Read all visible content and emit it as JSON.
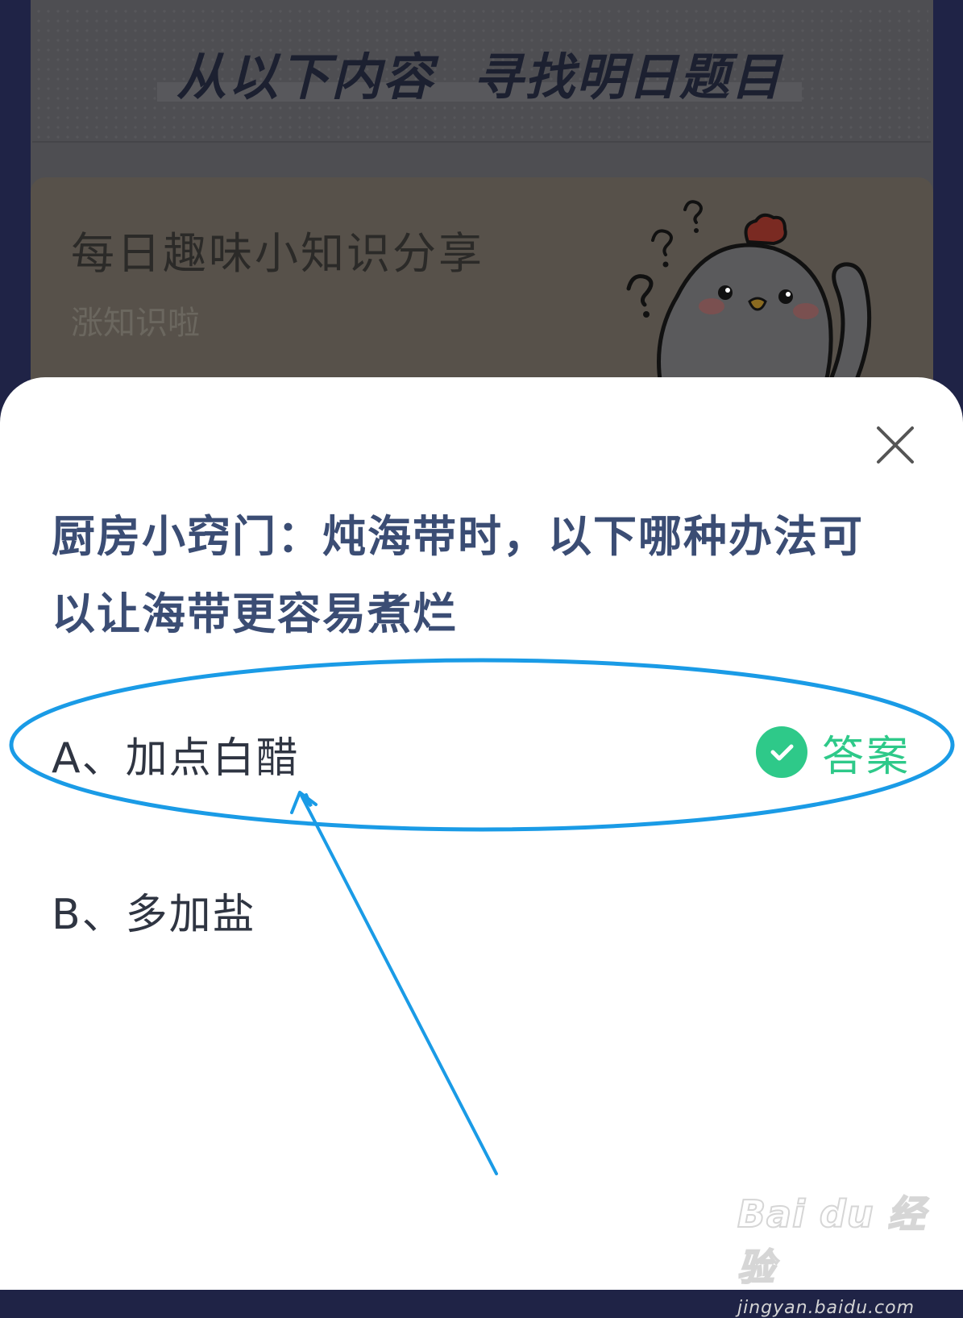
{
  "background": {
    "heading_left": "从以下内容",
    "heading_right": "寻找明日题目",
    "knowledge_title": "每日趣味小知识分享",
    "knowledge_subtitle": "涨知识啦"
  },
  "sheet": {
    "question": "厨房小窍门：炖海带时，以下哪种办法可以让海带更容易煮烂",
    "options": [
      {
        "label": "A、加点白醋",
        "is_answer": true
      },
      {
        "label": "B、多加盐",
        "is_answer": false
      }
    ],
    "answer_label": "答案"
  },
  "watermark": {
    "logo": "Bai du 经验",
    "url": "jingyan.baidu.com"
  },
  "colors": {
    "accent_green": "#2ec989",
    "question_text": "#3b4d74",
    "annotation_blue": "#1a9be6"
  },
  "icons": [
    "close-icon",
    "check-icon",
    "mascot-chicken-icon"
  ]
}
